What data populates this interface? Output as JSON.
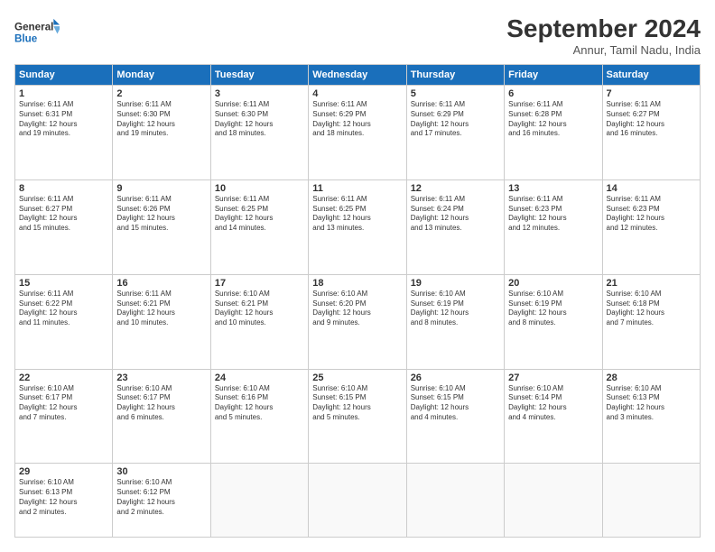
{
  "logo": {
    "line1": "General",
    "line2": "Blue"
  },
  "title": "September 2024",
  "subtitle": "Annur, Tamil Nadu, India",
  "days_header": [
    "Sunday",
    "Monday",
    "Tuesday",
    "Wednesday",
    "Thursday",
    "Friday",
    "Saturday"
  ],
  "weeks": [
    [
      {
        "day": "1",
        "info": "Sunrise: 6:11 AM\nSunset: 6:31 PM\nDaylight: 12 hours\nand 19 minutes."
      },
      {
        "day": "2",
        "info": "Sunrise: 6:11 AM\nSunset: 6:30 PM\nDaylight: 12 hours\nand 19 minutes."
      },
      {
        "day": "3",
        "info": "Sunrise: 6:11 AM\nSunset: 6:30 PM\nDaylight: 12 hours\nand 18 minutes."
      },
      {
        "day": "4",
        "info": "Sunrise: 6:11 AM\nSunset: 6:29 PM\nDaylight: 12 hours\nand 18 minutes."
      },
      {
        "day": "5",
        "info": "Sunrise: 6:11 AM\nSunset: 6:29 PM\nDaylight: 12 hours\nand 17 minutes."
      },
      {
        "day": "6",
        "info": "Sunrise: 6:11 AM\nSunset: 6:28 PM\nDaylight: 12 hours\nand 16 minutes."
      },
      {
        "day": "7",
        "info": "Sunrise: 6:11 AM\nSunset: 6:27 PM\nDaylight: 12 hours\nand 16 minutes."
      }
    ],
    [
      {
        "day": "8",
        "info": "Sunrise: 6:11 AM\nSunset: 6:27 PM\nDaylight: 12 hours\nand 15 minutes."
      },
      {
        "day": "9",
        "info": "Sunrise: 6:11 AM\nSunset: 6:26 PM\nDaylight: 12 hours\nand 15 minutes."
      },
      {
        "day": "10",
        "info": "Sunrise: 6:11 AM\nSunset: 6:25 PM\nDaylight: 12 hours\nand 14 minutes."
      },
      {
        "day": "11",
        "info": "Sunrise: 6:11 AM\nSunset: 6:25 PM\nDaylight: 12 hours\nand 13 minutes."
      },
      {
        "day": "12",
        "info": "Sunrise: 6:11 AM\nSunset: 6:24 PM\nDaylight: 12 hours\nand 13 minutes."
      },
      {
        "day": "13",
        "info": "Sunrise: 6:11 AM\nSunset: 6:23 PM\nDaylight: 12 hours\nand 12 minutes."
      },
      {
        "day": "14",
        "info": "Sunrise: 6:11 AM\nSunset: 6:23 PM\nDaylight: 12 hours\nand 12 minutes."
      }
    ],
    [
      {
        "day": "15",
        "info": "Sunrise: 6:11 AM\nSunset: 6:22 PM\nDaylight: 12 hours\nand 11 minutes."
      },
      {
        "day": "16",
        "info": "Sunrise: 6:11 AM\nSunset: 6:21 PM\nDaylight: 12 hours\nand 10 minutes."
      },
      {
        "day": "17",
        "info": "Sunrise: 6:10 AM\nSunset: 6:21 PM\nDaylight: 12 hours\nand 10 minutes."
      },
      {
        "day": "18",
        "info": "Sunrise: 6:10 AM\nSunset: 6:20 PM\nDaylight: 12 hours\nand 9 minutes."
      },
      {
        "day": "19",
        "info": "Sunrise: 6:10 AM\nSunset: 6:19 PM\nDaylight: 12 hours\nand 8 minutes."
      },
      {
        "day": "20",
        "info": "Sunrise: 6:10 AM\nSunset: 6:19 PM\nDaylight: 12 hours\nand 8 minutes."
      },
      {
        "day": "21",
        "info": "Sunrise: 6:10 AM\nSunset: 6:18 PM\nDaylight: 12 hours\nand 7 minutes."
      }
    ],
    [
      {
        "day": "22",
        "info": "Sunrise: 6:10 AM\nSunset: 6:17 PM\nDaylight: 12 hours\nand 7 minutes."
      },
      {
        "day": "23",
        "info": "Sunrise: 6:10 AM\nSunset: 6:17 PM\nDaylight: 12 hours\nand 6 minutes."
      },
      {
        "day": "24",
        "info": "Sunrise: 6:10 AM\nSunset: 6:16 PM\nDaylight: 12 hours\nand 5 minutes."
      },
      {
        "day": "25",
        "info": "Sunrise: 6:10 AM\nSunset: 6:15 PM\nDaylight: 12 hours\nand 5 minutes."
      },
      {
        "day": "26",
        "info": "Sunrise: 6:10 AM\nSunset: 6:15 PM\nDaylight: 12 hours\nand 4 minutes."
      },
      {
        "day": "27",
        "info": "Sunrise: 6:10 AM\nSunset: 6:14 PM\nDaylight: 12 hours\nand 4 minutes."
      },
      {
        "day": "28",
        "info": "Sunrise: 6:10 AM\nSunset: 6:13 PM\nDaylight: 12 hours\nand 3 minutes."
      }
    ],
    [
      {
        "day": "29",
        "info": "Sunrise: 6:10 AM\nSunset: 6:13 PM\nDaylight: 12 hours\nand 2 minutes."
      },
      {
        "day": "30",
        "info": "Sunrise: 6:10 AM\nSunset: 6:12 PM\nDaylight: 12 hours\nand 2 minutes."
      },
      {
        "day": "",
        "info": ""
      },
      {
        "day": "",
        "info": ""
      },
      {
        "day": "",
        "info": ""
      },
      {
        "day": "",
        "info": ""
      },
      {
        "day": "",
        "info": ""
      }
    ]
  ]
}
